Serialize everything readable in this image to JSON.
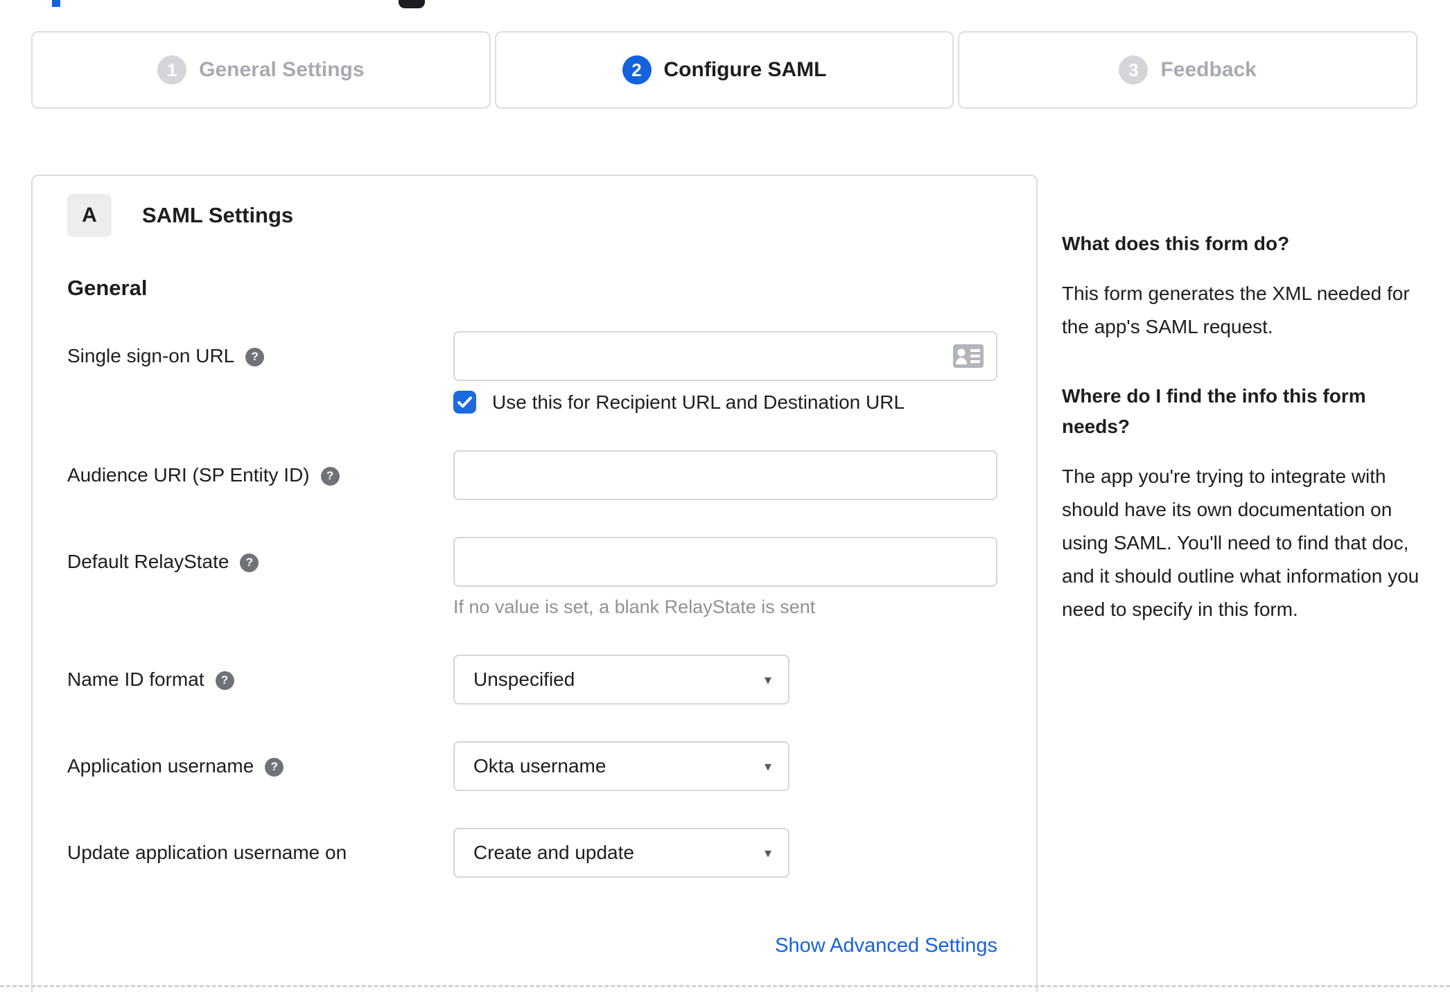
{
  "colors": {
    "accent_blue": "#1662dd",
    "checkbox_blue": "#1c6ae0",
    "inactive_step_circle": "#d3d5d9",
    "inactive_step_text": "#a7aab0",
    "border_gray": "#d5d6da",
    "hint_gray": "#8f9296",
    "help_icon_gray": "#6f7378"
  },
  "icons": {
    "help_glyph": "?",
    "caret_glyph": "▾"
  },
  "stepper": {
    "steps": [
      {
        "number": "1",
        "label": "General Settings"
      },
      {
        "number": "2",
        "label": "Configure SAML"
      },
      {
        "number": "3",
        "label": "Feedback"
      }
    ]
  },
  "panel": {
    "badge": "A",
    "title": "SAML Settings",
    "section_heading": "General",
    "fields": [
      {
        "label": "Single sign-on URL",
        "value": "",
        "checkbox_label": "Use this for Recipient URL and Destination URL",
        "checkbox_checked": "true"
      },
      {
        "label": "Audience URI (SP Entity ID)",
        "value": ""
      },
      {
        "label": "Default RelayState",
        "value": "",
        "hint": "If no value is set, a blank RelayState is sent"
      },
      {
        "label": "Name ID format",
        "value": "Unspecified"
      },
      {
        "label": "Application username",
        "value": "Okta username"
      },
      {
        "label": "Update application username on",
        "value": "Create and update"
      }
    ],
    "advanced_link": "Show Advanced Settings"
  },
  "sidebar": {
    "sections": [
      {
        "heading": "What does this form do?",
        "body": "This form generates the XML needed for the app's SAML request."
      },
      {
        "heading": "Where do I find the info this form needs?",
        "body": "The app you're trying to integrate with should have its own documentation on using SAML. You'll need to find that doc, and it should outline what information you need to specify in this form."
      }
    ]
  }
}
